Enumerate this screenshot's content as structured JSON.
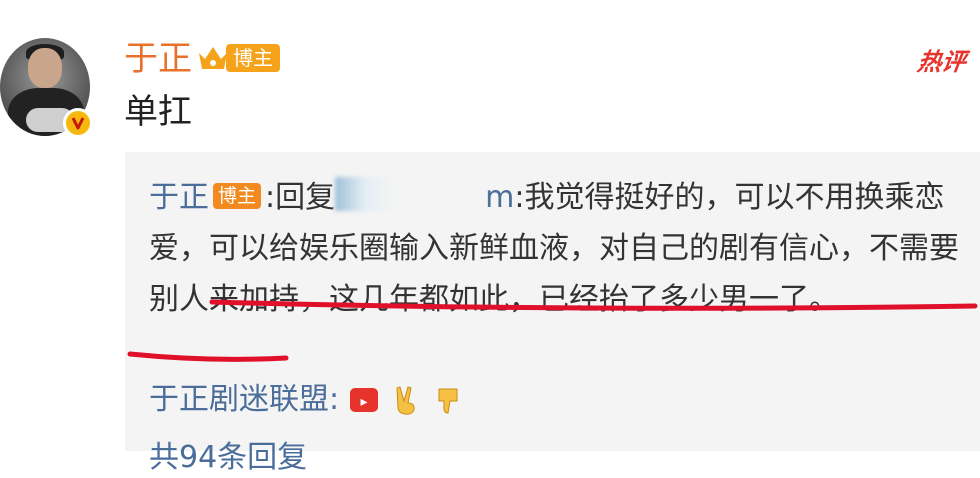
{
  "post": {
    "author": "于正",
    "author_badge": "博主",
    "hot_label": "热评",
    "text": "单扛"
  },
  "reply": {
    "author": "于正",
    "author_badge": "博主",
    "prefix": ":回复",
    "mention_tail": "m",
    "text": ":我觉得挺好的，可以不用换乘恋爱，可以给娱乐圈输入新鲜血液，对自己的剧有信心，不需要别人来加持，这几年都如此，已经抬了多少男一了。"
  },
  "subreply": {
    "author": "于正剧迷联盟",
    "colon": ":"
  },
  "more": {
    "label": "共94条回复"
  },
  "colors": {
    "username": "#e8722a",
    "link_blue": "#4a6d9a",
    "underline": "#e0102a",
    "hot": "#e8332c"
  }
}
